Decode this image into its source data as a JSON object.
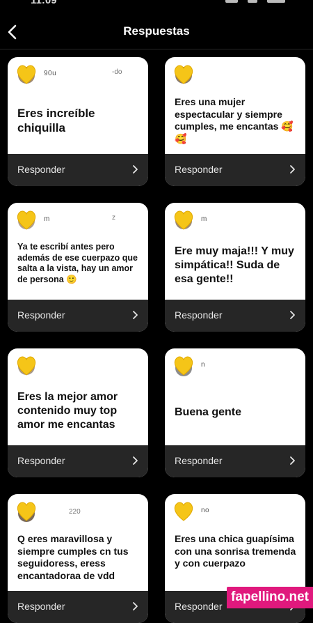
{
  "header": {
    "title": "Respuestas"
  },
  "status_bar": {
    "time": "11:09"
  },
  "cards": [
    {
      "username": "90u",
      "username_tail": "-do",
      "message": "Eres increíble chiquilla",
      "reply_label": "Responder"
    },
    {
      "username": "",
      "username_tail": "",
      "message": "Eres una mujer espectacular y siempre cumples, me encantas 🥰🥰",
      "reply_label": "Responder"
    },
    {
      "username": "m",
      "username_tail": "z",
      "message": "Ya te escribí antes pero además de ese cuerpazo que salta a la vista, hay un amor de persona 🙂",
      "reply_label": "Responder"
    },
    {
      "username": "m",
      "username_tail": "",
      "message": "Ere muy maja!!! Y muy simpática!! Suda de esa gente!!",
      "reply_label": "Responder"
    },
    {
      "username": "",
      "username_tail": "",
      "message": "Eres la mejor amor contenido muy top amor me encantas",
      "reply_label": "Responder"
    },
    {
      "username": "n",
      "username_tail": "",
      "message": "Buena gente",
      "reply_label": "Responder"
    },
    {
      "username": "",
      "username_tail": "220",
      "message": "Q eres maravillosa y siempre cumples cn tus seguidoress, eress encantadoraa de vdd",
      "reply_label": "Responder"
    },
    {
      "username": "no",
      "username_tail": "",
      "message": "Eres una chica guapísima con una sonrisa tremenda y con cuerpazo",
      "reply_label": "Responder"
    }
  ],
  "watermark": "fapellino.net",
  "colors": {
    "background": "#000000",
    "card": "#ffffff",
    "card_footer": "#262626",
    "avatar_heart": "#f5c518",
    "watermark": "#e0197d"
  }
}
